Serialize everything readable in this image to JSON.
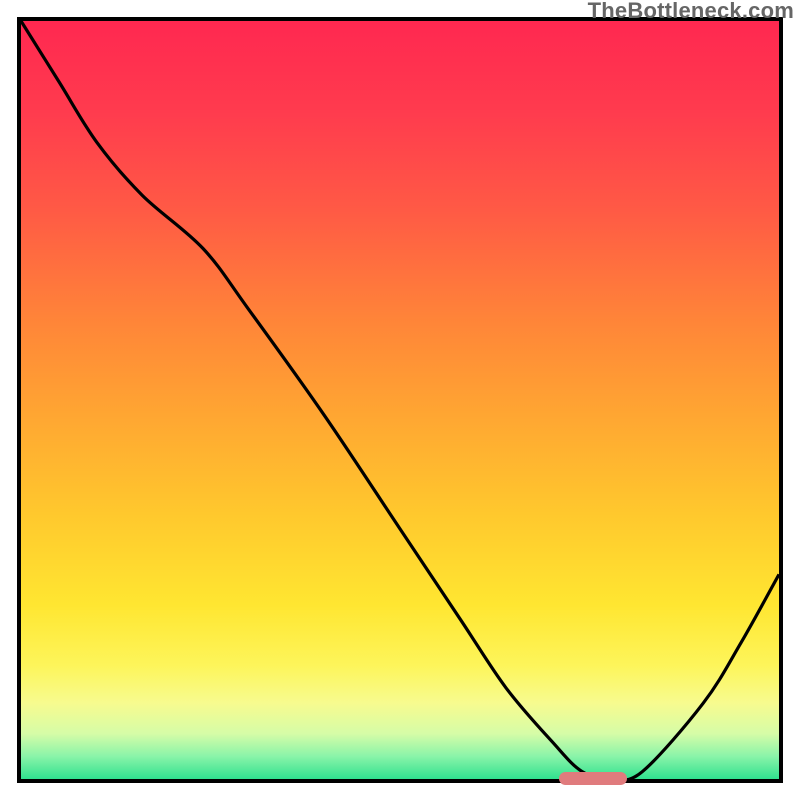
{
  "watermark": "TheBottleneck.com",
  "colors": {
    "frame": "#000000",
    "curve": "#000000",
    "dip_bar": "#e07b7d"
  },
  "chart_data": {
    "type": "line",
    "title": "",
    "xlabel": "",
    "ylabel": "",
    "xlim": [
      0,
      100
    ],
    "ylim": [
      0,
      100
    ],
    "series": [
      {
        "name": "bottleneck-curve",
        "x": [
          0,
          5,
          10,
          16,
          24,
          30,
          40,
          50,
          58,
          64,
          70,
          74,
          78,
          82,
          90,
          95,
          100
        ],
        "y": [
          100,
          92,
          84,
          77,
          70,
          62,
          48,
          33,
          21,
          12,
          5,
          1,
          0,
          1,
          10,
          18,
          27
        ]
      }
    ],
    "annotations": [
      {
        "type": "bar",
        "name": "dip-bar",
        "x_start": 71,
        "x_end": 80,
        "y": 0
      }
    ]
  }
}
